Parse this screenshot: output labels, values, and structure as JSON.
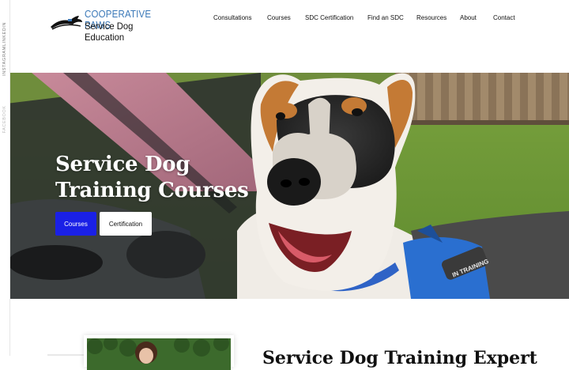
{
  "brand": {
    "line1": "COOPERATIVE PAWS",
    "line2": "Service Dog Education"
  },
  "nav": {
    "items": [
      {
        "label": "Consultations"
      },
      {
        "label": "Courses"
      },
      {
        "label": "SDC Certification"
      },
      {
        "label": "Find an SDC"
      },
      {
        "label": "Resources"
      },
      {
        "label": "About"
      },
      {
        "label": "Contact"
      }
    ]
  },
  "social": {
    "items": [
      "LINKEDIN",
      "INSTAGRAM",
      "FACEBOOK"
    ],
    "separator": "·"
  },
  "hero": {
    "title": "Service Dog Training Courses",
    "primary_button": "Courses",
    "secondary_button": "Certification",
    "vest_patch": "IN TRAINING"
  },
  "section": {
    "title": "Service Dog Training Expert"
  },
  "colors": {
    "accent": "#1a20e6",
    "brand_blue": "#3a78b8",
    "text": "#111111"
  }
}
